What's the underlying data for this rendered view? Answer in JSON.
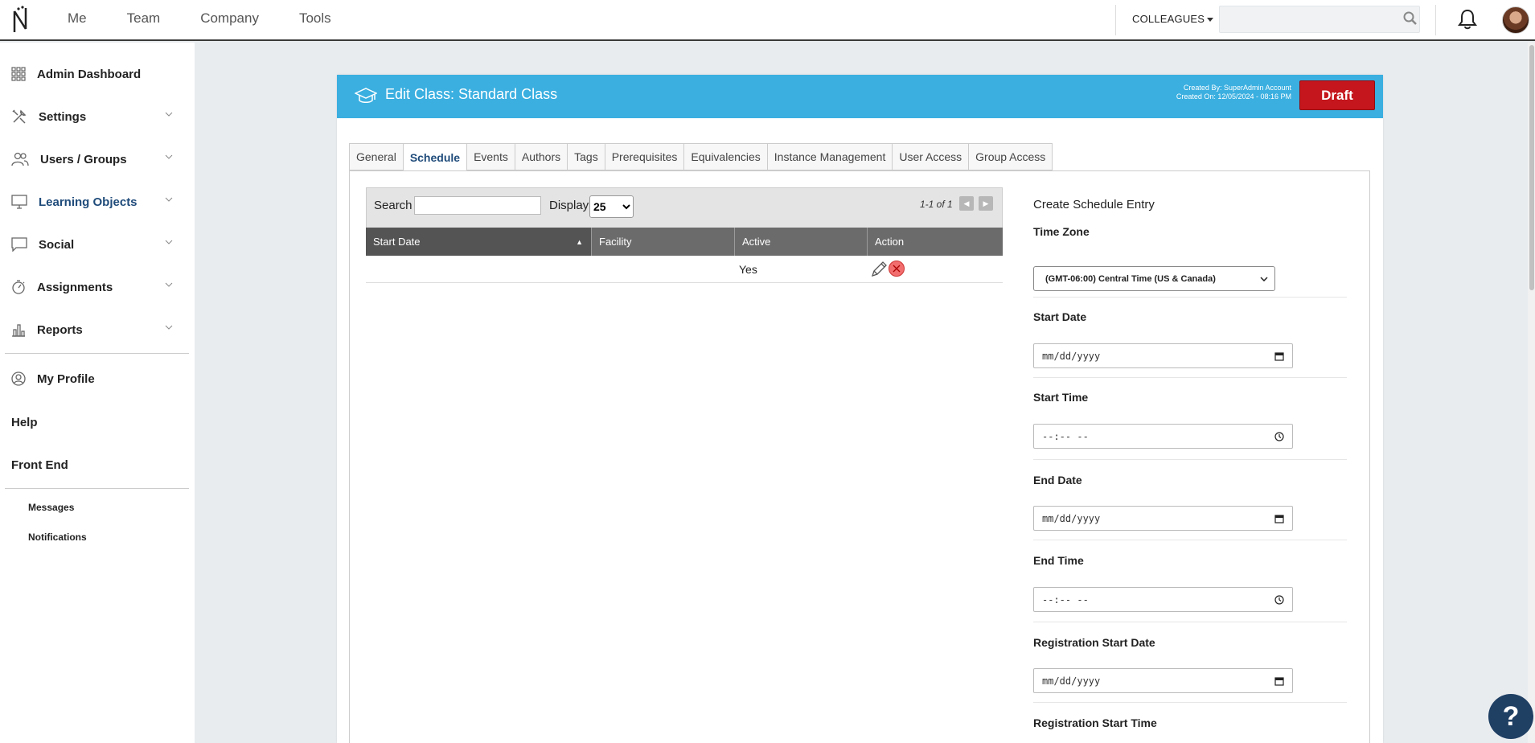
{
  "topbar": {
    "nav": [
      "Me",
      "Team",
      "Company",
      "Tools"
    ],
    "colleagues_label": "COLLEAGUES",
    "search_placeholder": ""
  },
  "sidebar": {
    "items": [
      {
        "label": "Admin Dashboard",
        "icon": "dashboard-grid-icon"
      },
      {
        "label": "Settings",
        "icon": "tools-icon"
      },
      {
        "label": "Users / Groups",
        "icon": "users-icon"
      },
      {
        "label": "Learning Objects",
        "icon": "monitor-icon"
      },
      {
        "label": "Social",
        "icon": "chat-icon"
      },
      {
        "label": "Assignments",
        "icon": "stopwatch-icon"
      },
      {
        "label": "Reports",
        "icon": "bar-chart-icon"
      }
    ],
    "my_profile": "My Profile",
    "help": "Help",
    "front_end": "Front End",
    "messages": "Messages",
    "notifications": "Notifications"
  },
  "panel": {
    "title": "Edit Class: Standard Class",
    "created_by": "Created By: SuperAdmin Account",
    "created_on": "Created On: 12/05/2024 - 08:16 PM",
    "status_button": "Draft",
    "tabs": [
      "General",
      "Schedule",
      "Events",
      "Authors",
      "Tags",
      "Prerequisites",
      "Equivalencies",
      "Instance Management",
      "User Access",
      "Group Access"
    ],
    "active_tab": "Schedule"
  },
  "grid": {
    "search_label": "Search",
    "search_value": "",
    "display_label": "Display",
    "display_value": "25",
    "pager_text": "1-1 of 1",
    "columns": [
      "Start Date",
      "Facility",
      "Active",
      "Action"
    ],
    "sort_indicator": "▲",
    "rows": [
      {
        "start_date": "",
        "facility": "",
        "active": "Yes"
      }
    ]
  },
  "form": {
    "title": "Create Schedule Entry",
    "time_zone_label": "Time Zone",
    "time_zone_value": "(GMT-06:00) Central Time (US & Canada)",
    "start_date_label": "Start Date",
    "start_date_placeholder": "mm/dd/yyyy",
    "start_time_label": "Start Time",
    "start_time_placeholder": "--:-- --",
    "end_date_label": "End Date",
    "end_date_placeholder": "mm/dd/yyyy",
    "end_time_label": "End Time",
    "end_time_placeholder": "--:-- --",
    "reg_start_date_label": "Registration Start Date",
    "reg_start_date_placeholder": "mm/dd/yyyy",
    "reg_start_time_label": "Registration Start Time"
  },
  "help_button": "?"
}
